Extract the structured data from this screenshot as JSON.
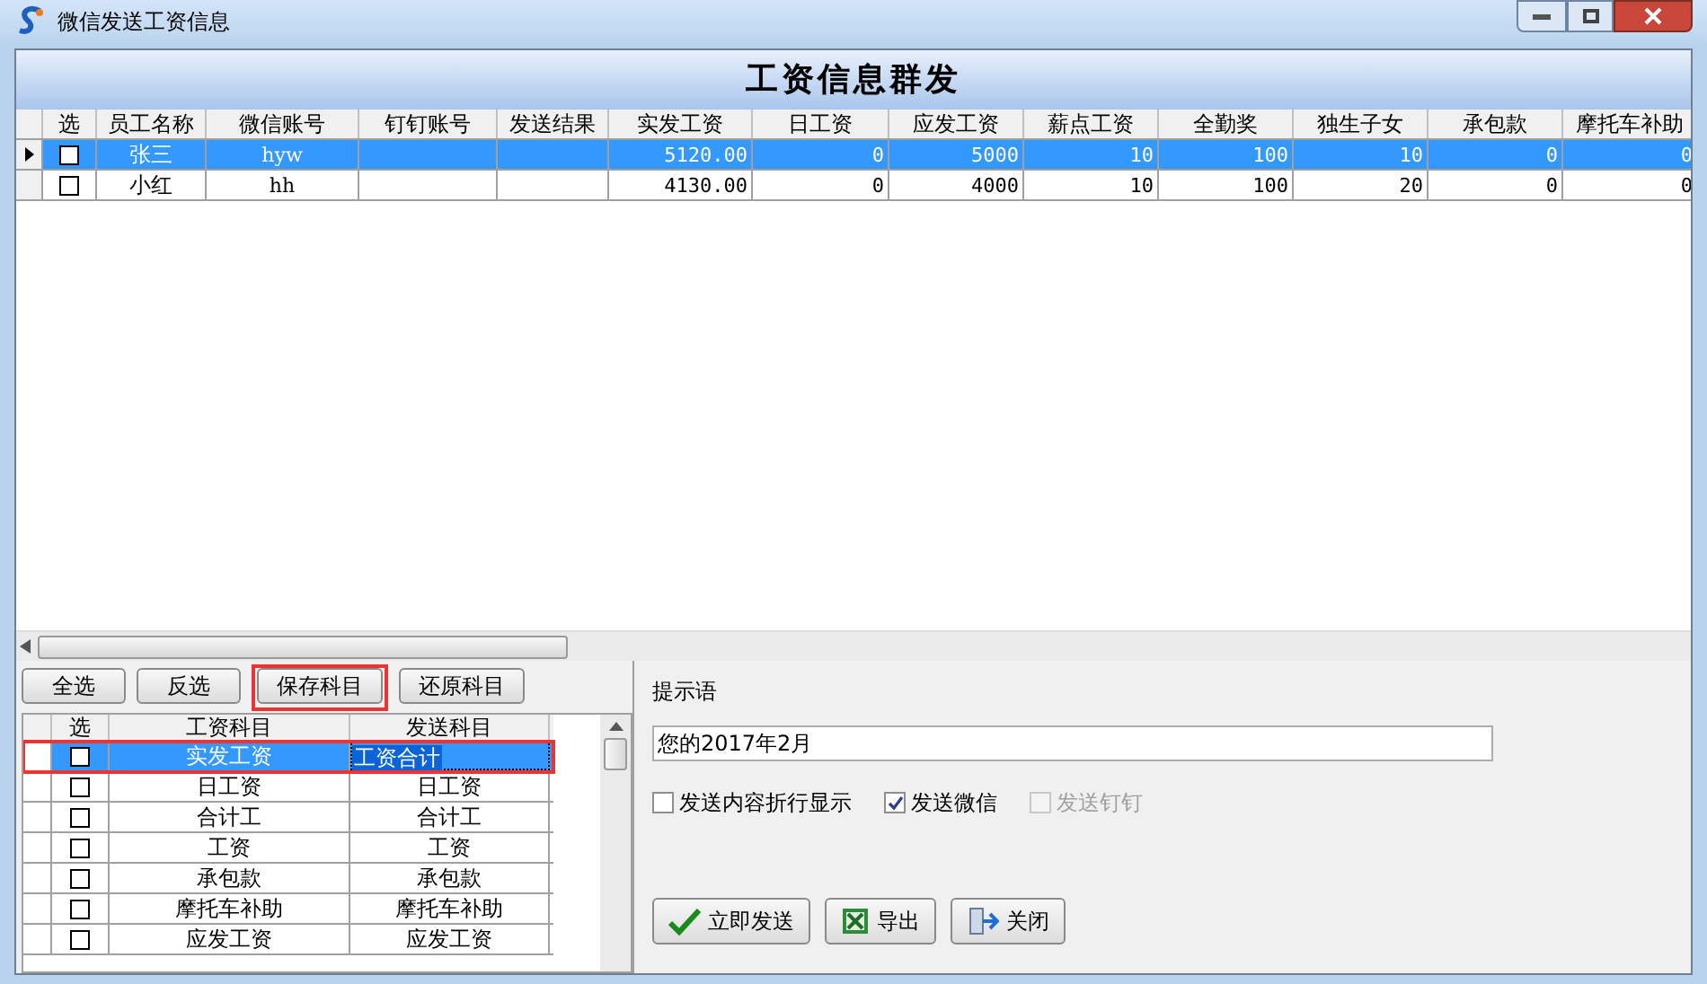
{
  "window": {
    "title": "微信发送工资信息"
  },
  "header": "工资信息群发",
  "table": {
    "check_column": "选",
    "columns": [
      "员工名称",
      "微信账号",
      "钉钉账号",
      "发送结果",
      "实发工资",
      "日工资",
      "应发工资",
      "薪点工资",
      "全勤奖",
      "独生子女",
      "承包款",
      "摩托车补助"
    ],
    "rows": [
      {
        "selected": true,
        "checked": false,
        "cells": [
          "张三",
          "hyw",
          "",
          "",
          "5120.00",
          "0",
          "5000",
          "10",
          "100",
          "10",
          "0",
          "0"
        ]
      },
      {
        "selected": false,
        "checked": false,
        "cells": [
          "小红",
          "hh",
          "",
          "",
          "4130.00",
          "0",
          "4000",
          "10",
          "100",
          "20",
          "0",
          "0"
        ]
      }
    ]
  },
  "item_buttons": [
    "全选",
    "反选",
    "保存科目",
    "还原科目"
  ],
  "items_table": {
    "check_column": "选",
    "columns": [
      "工资科目",
      "发送科目"
    ],
    "rows": [
      {
        "selected": true,
        "checked": false,
        "cells": [
          "实发工资",
          "工资合计"
        ]
      },
      {
        "selected": false,
        "checked": false,
        "cells": [
          "日工资",
          "日工资"
        ]
      },
      {
        "selected": false,
        "checked": false,
        "cells": [
          "合计工",
          "合计工"
        ]
      },
      {
        "selected": false,
        "checked": false,
        "cells": [
          "工资",
          "工资"
        ]
      },
      {
        "selected": false,
        "checked": false,
        "cells": [
          "承包款",
          "承包款"
        ]
      },
      {
        "selected": false,
        "checked": false,
        "cells": [
          "摩托车补助",
          "摩托车补助"
        ]
      },
      {
        "selected": false,
        "checked": false,
        "cells": [
          "应发工资",
          "应发工资"
        ]
      }
    ]
  },
  "prompt": {
    "label": "提示语",
    "value": "您的2017年2月"
  },
  "options": [
    {
      "label": "发送内容折行显示",
      "checked": false,
      "disabled": false
    },
    {
      "label": "发送微信",
      "checked": true,
      "disabled": false
    },
    {
      "label": "发送钉钉",
      "checked": false,
      "disabled": true
    }
  ],
  "actions": [
    {
      "kind": "send",
      "label": "立即发送"
    },
    {
      "kind": "export",
      "label": "导出"
    },
    {
      "kind": "close",
      "label": "关闭"
    }
  ]
}
